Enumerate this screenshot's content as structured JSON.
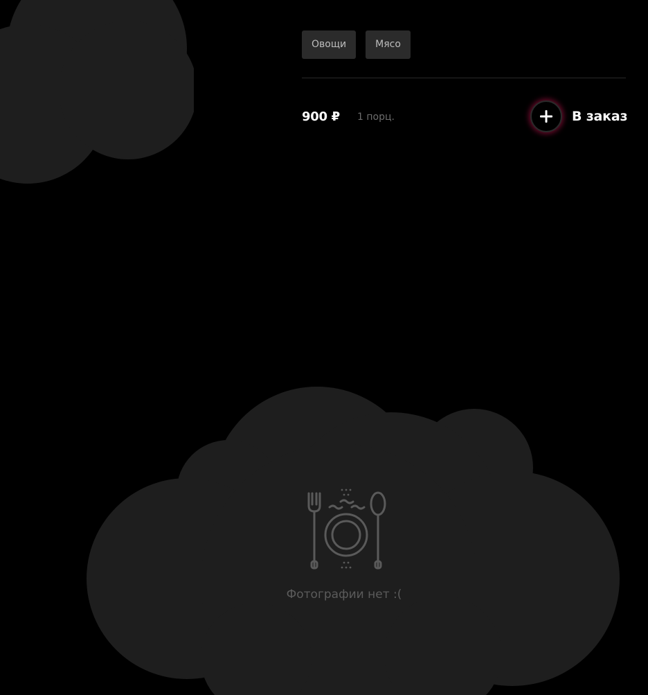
{
  "tags": [
    "Овощи",
    "Мясо"
  ],
  "price": "900 ₽",
  "portion": "1 порц.",
  "add_to_order_label": "В заказ",
  "no_photo_text": "Фотографии нет :(",
  "colors": {
    "background": "#000000",
    "cloud": "#1e1e1e",
    "tag_bg": "#2b2b2b",
    "accent_glow": "#c81450"
  },
  "icons": {
    "add": "plus-icon",
    "placeholder": "plate-cutlery-icon"
  }
}
